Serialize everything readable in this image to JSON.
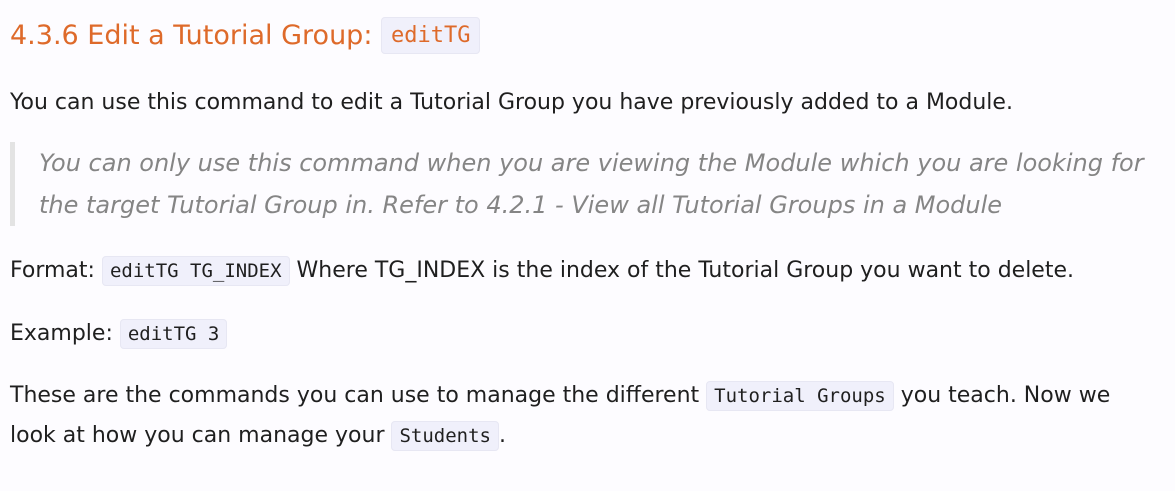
{
  "section": {
    "heading_text": "4.3.6 Edit a Tutorial Group: ",
    "heading_code": "editTG",
    "intro": "You can use this command to edit a Tutorial Group you have previously added to a Module.",
    "note": "You can only use this command when you are viewing the Module which you are looking for the target Tutorial Group in. Refer to 4.2.1 - View all Tutorial Groups in a Module",
    "format_label": "Format: ",
    "format_code": "editTG TG_INDEX",
    "format_desc": " Where TG_INDEX is the index of the Tutorial Group you want to delete.",
    "example_label": "Example: ",
    "example_code": "editTG 3",
    "closing_1": "These are the commands you can use to manage the different ",
    "closing_code_1": "Tutorial Groups",
    "closing_2": " you teach. Now we look at how you can manage your ",
    "closing_code_2": "Students",
    "closing_3": "."
  }
}
